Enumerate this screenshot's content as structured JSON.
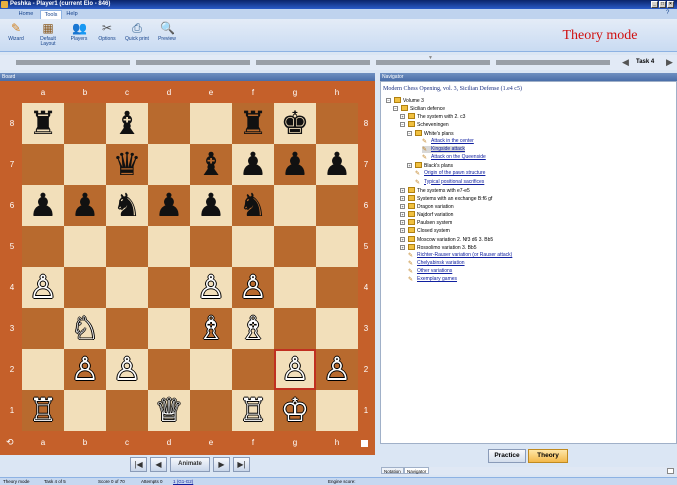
{
  "window": {
    "title": "Peshka - Player1 (current Elo - 846)"
  },
  "ribbon": {
    "tabs": [
      "Home",
      "Tools",
      "Help"
    ],
    "active_tab": "Tools",
    "buttons": [
      {
        "label": "Wizard",
        "icon": "wizard-icon"
      },
      {
        "label": "Default Layout",
        "icon": "layout-icon"
      },
      {
        "label": "Players",
        "icon": "players-icon"
      },
      {
        "label": "Options",
        "icon": "options-icon"
      },
      {
        "label": "Quick print",
        "icon": "print-icon"
      },
      {
        "label": "Preview",
        "icon": "preview-icon"
      }
    ]
  },
  "mode_label": "Theory mode",
  "task": {
    "label": "Task 4"
  },
  "panels": {
    "board": "Board",
    "navigator": "Navigator"
  },
  "board": {
    "files": [
      "a",
      "b",
      "c",
      "d",
      "e",
      "f",
      "g",
      "h"
    ],
    "ranks": [
      "8",
      "7",
      "6",
      "5",
      "4",
      "3",
      "2",
      "1"
    ],
    "pieces": [
      {
        "sq": "a8",
        "piece": "♜",
        "color": "black"
      },
      {
        "sq": "c8",
        "piece": "♝",
        "color": "black"
      },
      {
        "sq": "f8",
        "piece": "♜",
        "color": "black"
      },
      {
        "sq": "g8",
        "piece": "♚",
        "color": "black"
      },
      {
        "sq": "c7",
        "piece": "♛",
        "color": "black"
      },
      {
        "sq": "e7",
        "piece": "♝",
        "color": "black"
      },
      {
        "sq": "f7",
        "piece": "♟",
        "color": "black"
      },
      {
        "sq": "g7",
        "piece": "♟",
        "color": "black"
      },
      {
        "sq": "h7",
        "piece": "♟",
        "color": "black"
      },
      {
        "sq": "a6",
        "piece": "♟",
        "color": "black"
      },
      {
        "sq": "b6",
        "piece": "♟",
        "color": "black"
      },
      {
        "sq": "c6",
        "piece": "♞",
        "color": "black"
      },
      {
        "sq": "d6",
        "piece": "♟",
        "color": "black"
      },
      {
        "sq": "e6",
        "piece": "♟",
        "color": "black"
      },
      {
        "sq": "f6",
        "piece": "♞",
        "color": "black"
      },
      {
        "sq": "a4",
        "piece": "♙",
        "color": "white"
      },
      {
        "sq": "e4",
        "piece": "♙",
        "color": "white"
      },
      {
        "sq": "f4",
        "piece": "♙",
        "color": "white"
      },
      {
        "sq": "b3",
        "piece": "♘",
        "color": "white"
      },
      {
        "sq": "e3",
        "piece": "♗",
        "color": "white"
      },
      {
        "sq": "f3",
        "piece": "♗",
        "color": "white"
      },
      {
        "sq": "b2",
        "piece": "♙",
        "color": "white"
      },
      {
        "sq": "c2",
        "piece": "♙",
        "color": "white"
      },
      {
        "sq": "g2",
        "piece": "♙",
        "color": "white"
      },
      {
        "sq": "h2",
        "piece": "♙",
        "color": "white"
      },
      {
        "sq": "a1",
        "piece": "♖",
        "color": "white"
      },
      {
        "sq": "d1",
        "piece": "♕",
        "color": "white"
      },
      {
        "sq": "f1",
        "piece": "♖",
        "color": "white"
      },
      {
        "sq": "g1",
        "piece": "♔",
        "color": "white"
      }
    ],
    "selected_square": "g2"
  },
  "controls": {
    "animate": "Animate"
  },
  "navigator": {
    "title": "Modern Chess Opening, vol. 3, Sicilian Defense (1.e4 c5)",
    "tree": [
      {
        "label": "Volume 3",
        "level": 0,
        "type": "folder",
        "expander": "−"
      },
      {
        "label": "Sicilian defence",
        "level": 1,
        "type": "folder",
        "expander": "−"
      },
      {
        "label": "The system with 2. c3",
        "level": 2,
        "type": "folder",
        "expander": "+"
      },
      {
        "label": "Scheveningen",
        "level": 2,
        "type": "folder",
        "expander": "−"
      },
      {
        "label": "White's plans",
        "level": 3,
        "type": "folder",
        "expander": "−"
      },
      {
        "label": "Attack in the center",
        "level": 4,
        "type": "doc",
        "link": true
      },
      {
        "label": "Kingside attack",
        "level": 4,
        "type": "doc",
        "link": true,
        "selected": true
      },
      {
        "label": "Attack on the Queenside",
        "level": 4,
        "type": "doc",
        "link": true
      },
      {
        "label": "Black's plans",
        "level": 3,
        "type": "folder",
        "expander": "+"
      },
      {
        "label": "Origin of the pawn structure",
        "level": 3,
        "type": "doc",
        "link": true
      },
      {
        "label": "Typical positional sacrifices",
        "level": 3,
        "type": "doc",
        "link": true
      },
      {
        "label": "The systems with e7-e5",
        "level": 2,
        "type": "folder",
        "expander": "+"
      },
      {
        "label": "Systems with an exchange B:f6 gf",
        "level": 2,
        "type": "folder",
        "expander": "+"
      },
      {
        "label": "Dragon variation",
        "level": 2,
        "type": "folder",
        "expander": "+"
      },
      {
        "label": "Najdorf variation",
        "level": 2,
        "type": "folder",
        "expander": "+"
      },
      {
        "label": "Paulsen system",
        "level": 2,
        "type": "folder",
        "expander": "+"
      },
      {
        "label": "Closed system",
        "level": 2,
        "type": "folder",
        "expander": "+"
      },
      {
        "label": "Moscow variation 2. Nf3 d6 3. Bb5",
        "level": 2,
        "type": "folder",
        "expander": "+"
      },
      {
        "label": "Rossolimo variation 3. Bb5",
        "level": 2,
        "type": "folder",
        "expander": "+"
      },
      {
        "label": "Richter-Rauser variation (or Rauser attack)",
        "level": 2,
        "type": "doc",
        "link": true
      },
      {
        "label": "Chelyabinsk variation",
        "level": 2,
        "type": "doc",
        "link": true
      },
      {
        "label": "Other variations",
        "level": 2,
        "type": "doc",
        "link": true
      },
      {
        "label": "Exemplary games",
        "level": 2,
        "type": "doc",
        "link": true
      }
    ]
  },
  "mode_buttons": {
    "practice": "Practice",
    "theory": "Theory"
  },
  "bottom_tabs": [
    "Notation",
    "Navigator"
  ],
  "status": {
    "mode": "Theory mode",
    "task": "Task 4 of 5",
    "score": "Score 0 of 70",
    "attempts": "Attempts 0",
    "move": "1 (G1-G2)",
    "engine": "Engine score:"
  }
}
